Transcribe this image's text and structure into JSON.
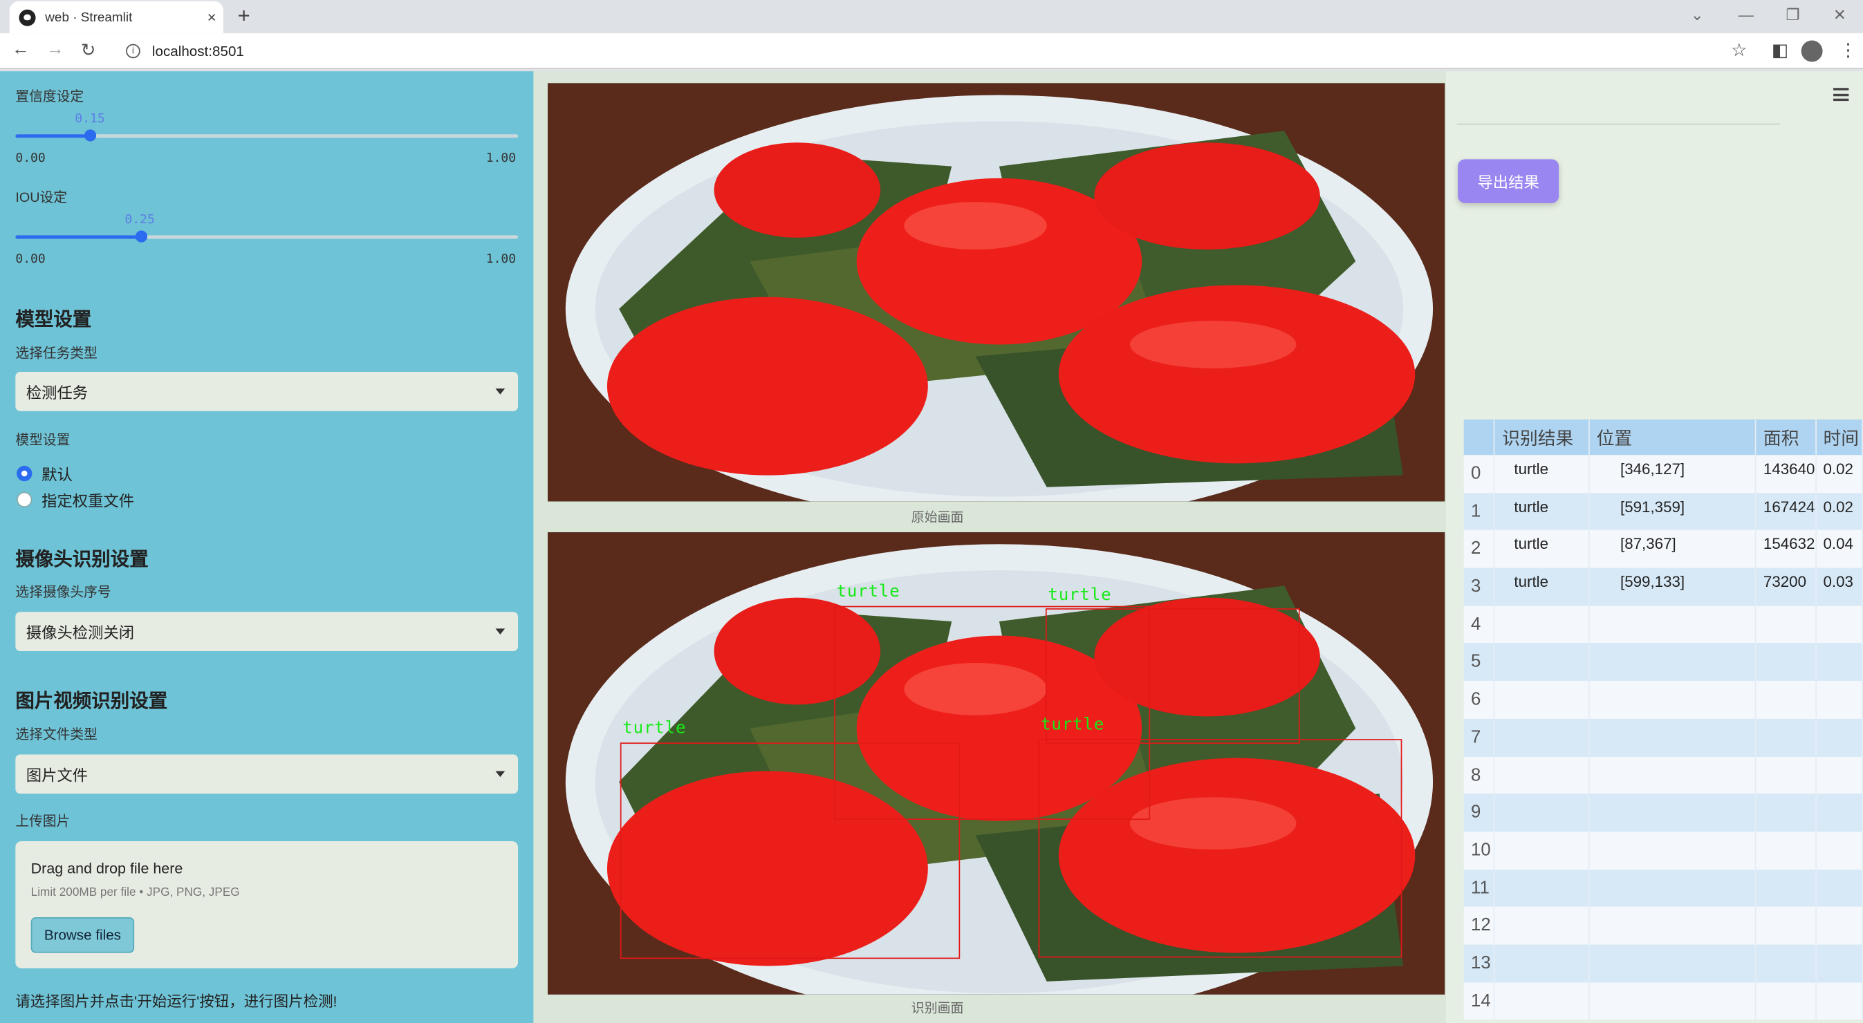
{
  "browser": {
    "tab_title": "web · Streamlit",
    "url": "localhost:8501",
    "new_tab": "+",
    "tab_close": "×"
  },
  "sidebar": {
    "confidence": {
      "label": "置信度设定",
      "value": "0.15",
      "min": "0.00",
      "max": "1.00",
      "fraction": 0.15
    },
    "iou": {
      "label": "IOU设定",
      "value": "0.25",
      "min": "0.00",
      "max": "1.00",
      "fraction": 0.25
    },
    "model_section": "模型设置",
    "task_label": "选择任务类型",
    "task_value": "检测任务",
    "model_label": "模型设置",
    "model_options": [
      "默认",
      "指定权重文件"
    ],
    "model_selected": 0,
    "camera_section": "摄像头识别设置",
    "camera_label": "选择摄像头序号",
    "camera_value": "摄像头检测关闭",
    "media_section": "图片视频识别设置",
    "file_type_label": "选择文件类型",
    "file_type_value": "图片文件",
    "upload_label": "上传图片",
    "upload_title": "Drag and drop file here",
    "upload_limit": "Limit 200MB per file • JPG, PNG, JPEG",
    "browse_label": "Browse files",
    "hint": "请选择图片并点击'开始运行'按钮，进行图片检测!"
  },
  "main": {
    "original_caption": "原始画面",
    "result_caption": "识别画面",
    "detection_label": "turtle"
  },
  "right": {
    "export_label": "导出结果"
  },
  "table": {
    "headers": [
      "",
      "识别结果",
      "位置",
      "面积",
      "时间"
    ],
    "rows": [
      [
        "0",
        "turtle",
        "[346,127]",
        "143640",
        "0.02"
      ],
      [
        "1",
        "turtle",
        "[591,359]",
        "167424",
        "0.02"
      ],
      [
        "2",
        "turtle",
        "[87,367]",
        "154632",
        "0.04"
      ],
      [
        "3",
        "turtle",
        "[599,133]",
        "73200",
        "0.03"
      ],
      [
        "4",
        "",
        "",
        "",
        ""
      ],
      [
        "5",
        "",
        "",
        "",
        ""
      ],
      [
        "6",
        "",
        "",
        "",
        ""
      ],
      [
        "7",
        "",
        "",
        "",
        ""
      ],
      [
        "8",
        "",
        "",
        "",
        ""
      ],
      [
        "9",
        "",
        "",
        "",
        ""
      ],
      [
        "10",
        "",
        "",
        "",
        ""
      ],
      [
        "11",
        "",
        "",
        "",
        ""
      ],
      [
        "12",
        "",
        "",
        "",
        ""
      ],
      [
        "13",
        "",
        "",
        "",
        ""
      ],
      [
        "14",
        "",
        "",
        "",
        ""
      ]
    ]
  },
  "colors": {
    "sidebar": "#6fc3d6",
    "accent": "#2b6bf0",
    "export": "#9a86f0",
    "detection_box": "#e21818",
    "detection_text": "#18e818"
  }
}
